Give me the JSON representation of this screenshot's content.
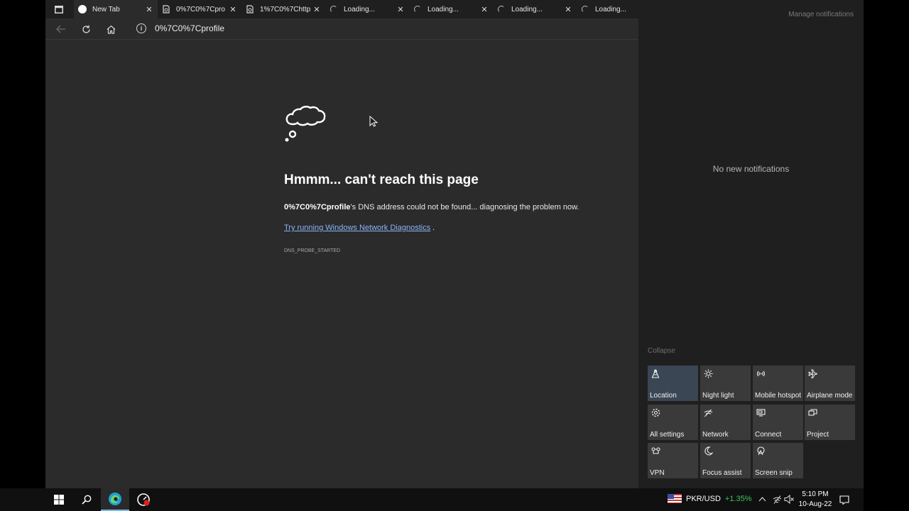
{
  "browser": {
    "tabs": [
      {
        "title": "New Tab",
        "favicon": "white-circle-icon",
        "active": true
      },
      {
        "title": "0%7C0%7Cpro",
        "favicon": "page-icon",
        "active": false
      },
      {
        "title": "1%7C0%7Chttp",
        "favicon": "page-icon",
        "active": false
      },
      {
        "title": "Loading...",
        "favicon": "spinner-icon",
        "active": false
      },
      {
        "title": "Loading...",
        "favicon": "spinner-icon",
        "active": false
      },
      {
        "title": "Loading...",
        "favicon": "spinner-icon",
        "active": false
      },
      {
        "title": "Loading...",
        "favicon": "spinner-icon",
        "active": false
      }
    ],
    "close_glyph": "✕",
    "address": "0%7C0%7Cprofile",
    "error": {
      "title": "Hmmm... can't reach this page",
      "host": "0%7C0%7Cprofile",
      "message": "'s DNS address could not be found... diagnosing the problem now.",
      "link": "Try running Windows Network Diagnostics",
      "link_suffix": ".",
      "code": "DNS_PROBE_STARTED"
    }
  },
  "action_center": {
    "manage": "Manage notifications",
    "empty": "No new notifications",
    "collapse": "Collapse",
    "tiles": [
      {
        "label": "Location",
        "icon": "location-icon",
        "active": true
      },
      {
        "label": "Night light",
        "icon": "night-light-icon",
        "active": false
      },
      {
        "label": "Mobile hotspot",
        "icon": "mobile-hotspot-icon",
        "active": false
      },
      {
        "label": "Airplane mode",
        "icon": "airplane-icon",
        "active": false
      },
      {
        "label": "All settings",
        "icon": "gear-icon",
        "active": false
      },
      {
        "label": "Network",
        "icon": "network-icon",
        "active": false
      },
      {
        "label": "Connect",
        "icon": "connect-icon",
        "active": false
      },
      {
        "label": "Project",
        "icon": "project-icon",
        "active": false
      },
      {
        "label": "VPN",
        "icon": "vpn-icon",
        "active": false
      },
      {
        "label": "Focus assist",
        "icon": "moon-icon",
        "active": false
      },
      {
        "label": "Screen snip",
        "icon": "screen-snip-icon",
        "active": false
      }
    ]
  },
  "taskbar": {
    "ticker": {
      "symbol": "PKR/USD",
      "change": "+1.35%"
    },
    "time": "5:10 PM",
    "date": "10-Aug-22"
  }
}
